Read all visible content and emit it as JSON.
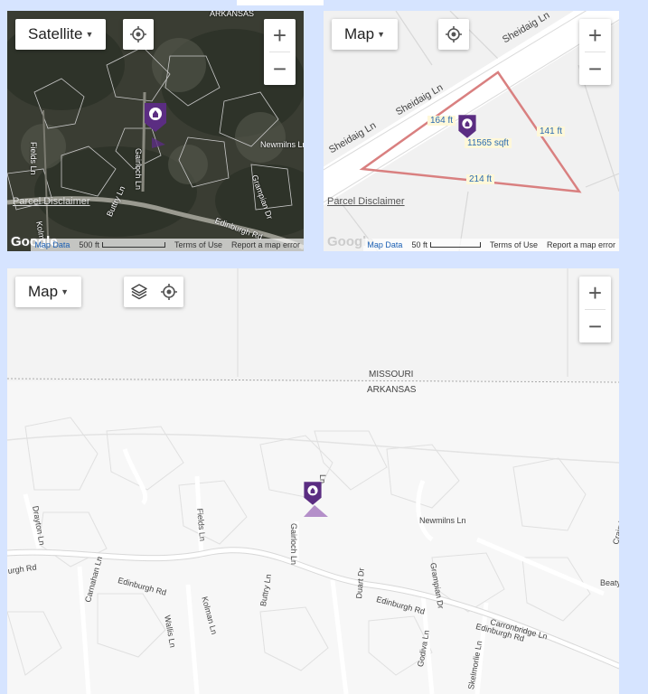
{
  "satellite_map": {
    "type_button": "Satellite",
    "zoom_in": "+",
    "zoom_out": "−",
    "disclaimer": "Parcel Disclaimer",
    "footer": {
      "map_data": "Map Data",
      "scale": "500 ft",
      "terms": "Terms of Use",
      "report": "Report a map error"
    },
    "logo": "Google",
    "labels": [
      "ARKANSAS",
      "Fields Ln",
      "Gairloch Ln",
      "Newmilns Ln",
      "Grampian Dr",
      "Buttry Ln",
      "Edinburgh Rd",
      "Kolm"
    ]
  },
  "parcel_map": {
    "type_button": "Map",
    "zoom_in": "+",
    "zoom_out": "−",
    "disclaimer": "Parcel Disclaimer",
    "footer": {
      "map_data": "Map Data",
      "scale": "50 ft",
      "terms": "Terms of Use",
      "report": "Report a map error"
    },
    "logo": "Google",
    "street_labels": [
      "Sheidaig Ln",
      "Sheidaig Ln",
      "Sheidaig Ln"
    ],
    "measurements": {
      "side_a": "164 ft",
      "side_b": "141 ft",
      "side_c": "214 ft",
      "area": "11565 sqft"
    },
    "parcel_outline_color": "#d98080"
  },
  "area_map": {
    "type_button": "Map",
    "zoom_in": "+",
    "zoom_out": "−",
    "state_labels": [
      "MISSOURI",
      "ARKANSAS"
    ],
    "street_labels": [
      "Drayton Ln",
      "Fields Ln",
      "Gairloch Ln",
      "Ln",
      "Newmilns Ln",
      "Grampian Dr",
      "Craig Ln",
      "Beaty",
      "urgh Rd",
      "Carnahan Ln",
      "Edinburgh Rd",
      "Wallis Ln",
      "Kolman Ln",
      "Buttry Ln",
      "Duart Dr",
      "Edinburgh Rd",
      "Carronbridge Ln",
      "Edinburgh Rd",
      "Godiva Ln",
      "Skelmorlie Ln"
    ]
  },
  "marker_color": "#5b2d82"
}
